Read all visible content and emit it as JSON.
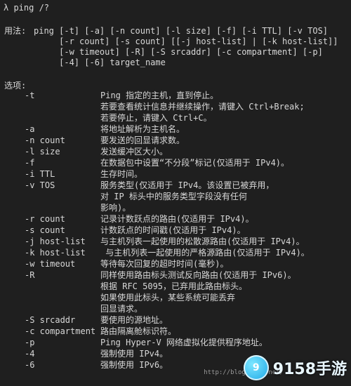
{
  "prompt": "λ ping /?",
  "usage_label": "用法:",
  "usage_lines": [
    "ping [-t] [-a] [-n count] [-l size] [-f] [-i TTL] [-v TOS]",
    "     [-r count] [-s count] [[-j host-list] | [-k host-list]]",
    "     [-w timeout] [-R] [-S srcaddr] [-c compartment] [-p]",
    "     [-4] [-6] target_name"
  ],
  "options_label": "选项:",
  "options": [
    {
      "key": "-t",
      "desc": [
        "Ping 指定的主机，直到停止。",
        "若要查看统计信息并继续操作，请键入 Ctrl+Break;",
        "若要停止，请键入 Ctrl+C。"
      ]
    },
    {
      "key": "-a",
      "desc": [
        "将地址解析为主机名。"
      ]
    },
    {
      "key": "-n count",
      "desc": [
        "要发送的回显请求数。"
      ]
    },
    {
      "key": "-l size",
      "desc": [
        "发送缓冲区大小。"
      ]
    },
    {
      "key": "-f",
      "desc": [
        "在数据包中设置“不分段”标记(仅适用于 IPv4)。"
      ]
    },
    {
      "key": "-i TTL",
      "desc": [
        "生存时间。"
      ]
    },
    {
      "key": "-v TOS",
      "desc": [
        "服务类型(仅适用于 IPv4。该设置已被弃用，",
        "对 IP 标头中的服务类型字段没有任何",
        "影响)。"
      ]
    },
    {
      "key": "-r count",
      "desc": [
        "记录计数跃点的路由(仅适用于 IPv4)。"
      ]
    },
    {
      "key": "-s count",
      "desc": [
        "计数跃点的时间戳(仅适用于 IPv4)。"
      ]
    },
    {
      "key": "-j host-list",
      "desc": [
        "与主机列表一起使用的松散源路由(仅适用于 IPv4)。"
      ]
    },
    {
      "key": "-k host-list",
      "desc": [
        " 与主机列表一起使用的严格源路由(仅适用于 IPv4)。"
      ]
    },
    {
      "key": "-w timeout",
      "desc": [
        "等待每次回复的超时时间(毫秒)。"
      ]
    },
    {
      "key": "-R",
      "desc": [
        "同样使用路由标头测试反向路由(仅适用于 IPv6)。",
        "根据 RFC 5095，已弃用此路由标头。",
        "如果使用此标头，某些系统可能丢弃",
        "回显请求。"
      ]
    },
    {
      "key": "-S srcaddr",
      "desc": [
        "要使用的源地址。"
      ]
    },
    {
      "key": "-c compartment",
      "desc": [
        "路由隔离舱标识符。"
      ]
    },
    {
      "key": "-p",
      "desc": [
        "Ping Hyper-V 网络虚拟化提供程序地址。"
      ]
    },
    {
      "key": "-4",
      "desc": [
        "强制使用 IPv4。"
      ]
    },
    {
      "key": "-6",
      "desc": [
        "强制使用 IPv6。"
      ]
    }
  ],
  "watermark": {
    "badge": "9",
    "text": "9158手游",
    "url": "http://blog.csdn.net/"
  }
}
